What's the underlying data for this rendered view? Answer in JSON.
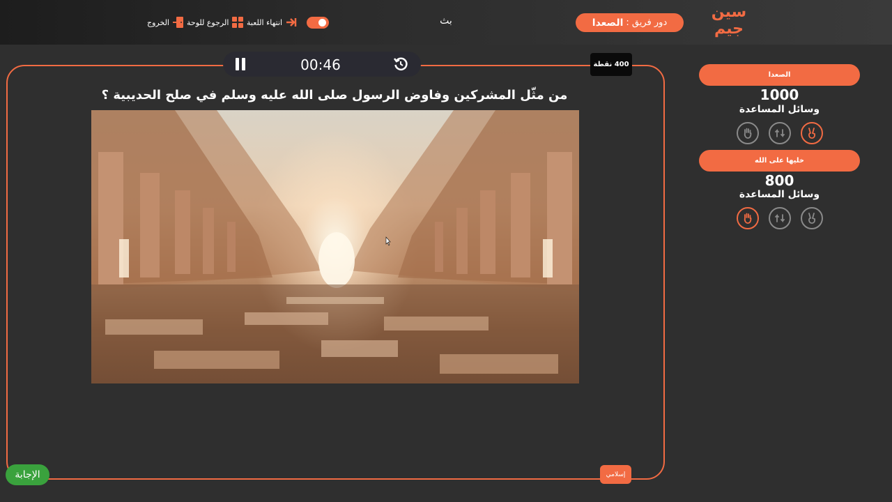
{
  "header": {
    "logo_text": "سين جيم",
    "turn_label": "دور فريق :",
    "turn_team": "الصعدا",
    "center_text": "بث",
    "end_game_label": "انتهاء اللعبة",
    "back_to_board_label": "الرجوع للوحة",
    "exit_label": "الخروج"
  },
  "question": {
    "timer": "00:46",
    "points": "400 نقطة",
    "text": "من مثّل المشركين وفاوض الرسول صلى الله عليه وسلم في صلح الحديبية ؟",
    "category": "إسلامي",
    "answer_label": "الإجابة"
  },
  "teams": [
    {
      "name": "الصعدا",
      "score": "1000",
      "help_label": "وسائل المساعدة"
    },
    {
      "name": "خليها على الله",
      "score": "800",
      "help_label": "وسائل المساعدة"
    }
  ],
  "colors": {
    "accent": "#f26b43",
    "answer": "#3aa23d",
    "background": "#2f2f2f"
  }
}
